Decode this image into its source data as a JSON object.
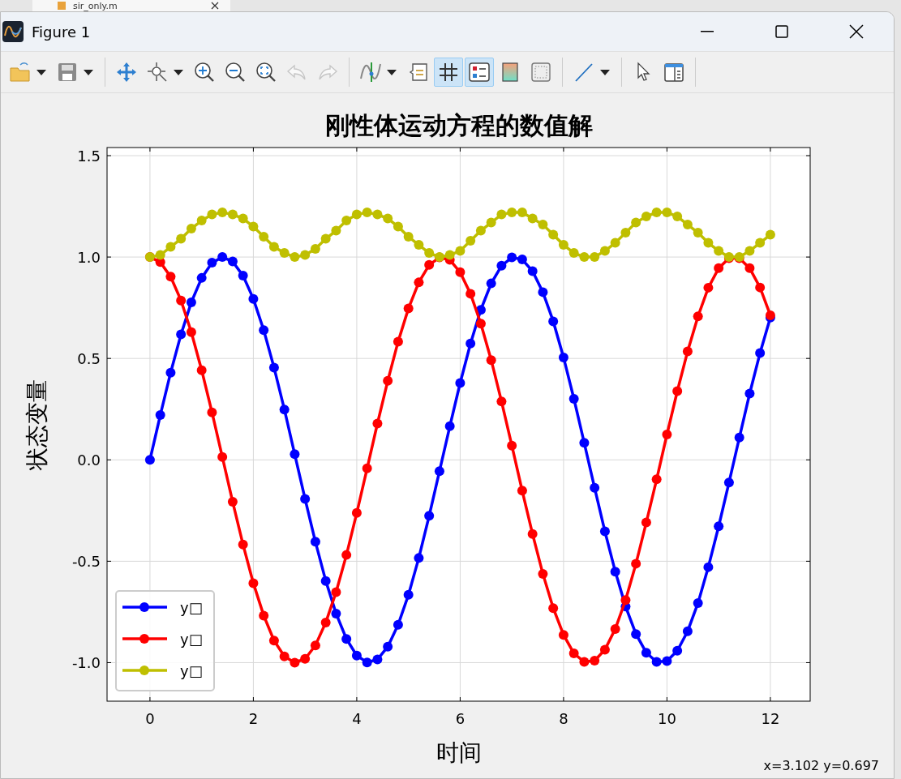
{
  "background_tab": {
    "label": "sir_only.m"
  },
  "window": {
    "title": "Figure 1"
  },
  "toolbar": {
    "groups": [
      {
        "items": [
          {
            "kind": "open",
            "has_menu": true,
            "selected": false,
            "disabled": false
          },
          {
            "kind": "save",
            "has_menu": true,
            "selected": false,
            "disabled": false
          }
        ]
      },
      {
        "items": [
          {
            "kind": "pan",
            "has_menu": false,
            "selected": false,
            "disabled": false
          },
          {
            "kind": "datatip",
            "has_menu": true,
            "selected": false,
            "disabled": false
          },
          {
            "kind": "zoom-in",
            "has_menu": false,
            "selected": false,
            "disabled": false
          },
          {
            "kind": "zoom-out",
            "has_menu": false,
            "selected": false,
            "disabled": false
          },
          {
            "kind": "zoom-fit",
            "has_menu": false,
            "selected": false,
            "disabled": false
          },
          {
            "kind": "undo",
            "has_menu": false,
            "selected": false,
            "disabled": true
          },
          {
            "kind": "redo",
            "has_menu": false,
            "selected": false,
            "disabled": true
          }
        ]
      },
      {
        "items": [
          {
            "kind": "curve",
            "has_menu": true,
            "selected": false,
            "disabled": false
          },
          {
            "kind": "note",
            "has_menu": false,
            "selected": false,
            "disabled": false
          },
          {
            "kind": "grid",
            "has_menu": false,
            "selected": true,
            "disabled": false
          },
          {
            "kind": "legend",
            "has_menu": false,
            "selected": true,
            "disabled": false
          },
          {
            "kind": "colorbar",
            "has_menu": false,
            "selected": false,
            "disabled": false
          },
          {
            "kind": "box",
            "has_menu": false,
            "selected": false,
            "disabled": false
          }
        ]
      },
      {
        "items": [
          {
            "kind": "line",
            "has_menu": true,
            "selected": false,
            "disabled": false
          }
        ]
      },
      {
        "items": [
          {
            "kind": "pointer",
            "has_menu": false,
            "selected": false,
            "disabled": false
          },
          {
            "kind": "panel",
            "has_menu": false,
            "selected": false,
            "disabled": false
          }
        ]
      }
    ]
  },
  "figure": {
    "chart_data": {
      "type": "line",
      "grid": true,
      "title": "刚性体运动方程的数值解",
      "xlabel": "时间",
      "ylabel": "状态变量",
      "x": [
        0,
        0.2,
        0.4,
        0.6,
        0.8,
        1,
        1.2,
        1.4,
        1.6,
        1.8,
        2,
        2.2,
        2.4,
        2.6,
        2.8,
        3,
        3.2,
        3.4,
        3.6,
        3.8,
        4,
        4.2,
        4.4,
        4.6,
        4.8,
        5,
        5.2,
        5.4,
        5.6,
        5.8,
        6,
        6.2,
        6.4,
        6.6,
        6.8,
        7,
        7.2,
        7.4,
        7.6,
        7.8,
        8,
        8.2,
        8.4,
        8.6,
        8.8,
        9,
        9.2,
        9.4,
        9.6,
        9.8,
        10,
        10.2,
        10.4,
        10.6,
        10.8,
        11,
        11.2,
        11.4,
        11.6,
        11.8,
        12
      ],
      "series": [
        {
          "name": "y□",
          "color": "#0000ff",
          "marker": "o",
          "values": [
            0,
            0.221,
            0.43,
            0.619,
            0.777,
            0.897,
            0.972,
            1,
            0.978,
            0.908,
            0.794,
            0.64,
            0.455,
            0.248,
            0.028,
            -0.193,
            -0.404,
            -0.597,
            -0.758,
            -0.883,
            -0.965,
            -0.999,
            -0.984,
            -0.921,
            -0.813,
            -0.665,
            -0.484,
            -0.276,
            -0.056,
            0.166,
            0.379,
            0.574,
            0.74,
            0.87,
            0.957,
            0.998,
            0.988,
            0.93,
            0.827,
            0.683,
            0.505,
            0.301,
            0.084,
            -0.138,
            -0.353,
            -0.551,
            -0.723,
            -0.859,
            -0.951,
            -0.996,
            -0.992,
            -0.941,
            -0.845,
            -0.706,
            -0.529,
            -0.328,
            -0.112,
            0.11,
            0.327,
            0.527,
            0.702
          ]
        },
        {
          "name": "y□",
          "color": "#ff0000",
          "marker": "o",
          "values": [
            1,
            0.975,
            0.903,
            0.786,
            0.63,
            0.442,
            0.234,
            0.014,
            -0.207,
            -0.418,
            -0.608,
            -0.768,
            -0.891,
            -0.969,
            -1,
            -0.981,
            -0.915,
            -0.802,
            -0.652,
            -0.469,
            -0.262,
            -0.042,
            0.179,
            0.39,
            0.583,
            0.747,
            0.875,
            0.961,
            0.998,
            0.986,
            0.925,
            0.819,
            0.672,
            0.492,
            0.288,
            0.07,
            -0.152,
            -0.366,
            -0.562,
            -0.731,
            -0.863,
            -0.954,
            -0.996,
            -0.99,
            -0.936,
            -0.834,
            -0.691,
            -0.512,
            -0.309,
            -0.096,
            0.125,
            0.339,
            0.535,
            0.708,
            0.849,
            0.945,
            0.994,
            0.994,
            0.945,
            0.85,
            0.713
          ]
        },
        {
          "name": "y□",
          "color": "#bfbf00",
          "marker": "o",
          "values": [
            1,
            1.01,
            1.05,
            1.09,
            1.14,
            1.18,
            1.21,
            1.22,
            1.21,
            1.19,
            1.15,
            1.1,
            1.05,
            1.02,
            1,
            1.01,
            1.04,
            1.09,
            1.13,
            1.18,
            1.21,
            1.22,
            1.21,
            1.19,
            1.15,
            1.1,
            1.06,
            1.02,
            1,
            1.01,
            1.03,
            1.08,
            1.13,
            1.17,
            1.21,
            1.22,
            1.22,
            1.19,
            1.16,
            1.11,
            1.06,
            1.02,
            1,
            1,
            1.03,
            1.07,
            1.12,
            1.17,
            1.2,
            1.22,
            1.22,
            1.2,
            1.16,
            1.12,
            1.07,
            1.03,
            1,
            1,
            1.03,
            1.07,
            1.11
          ]
        }
      ],
      "xlim": [
        -0.83,
        12.77
      ],
      "ylim": [
        -1.19,
        1.54
      ],
      "xticks": [
        0,
        2,
        4,
        6,
        8,
        10,
        12
      ],
      "yticks": [
        {
          "value": -1,
          "label": "-1.0"
        },
        {
          "value": -0.5,
          "label": "-0.5"
        },
        {
          "value": 0,
          "label": "0.0"
        },
        {
          "value": 0.5,
          "label": "0.5"
        },
        {
          "value": 1,
          "label": "1.0"
        },
        {
          "value": 1.5,
          "label": "1.5"
        }
      ]
    },
    "status": "x=3.102 y=0.697"
  }
}
